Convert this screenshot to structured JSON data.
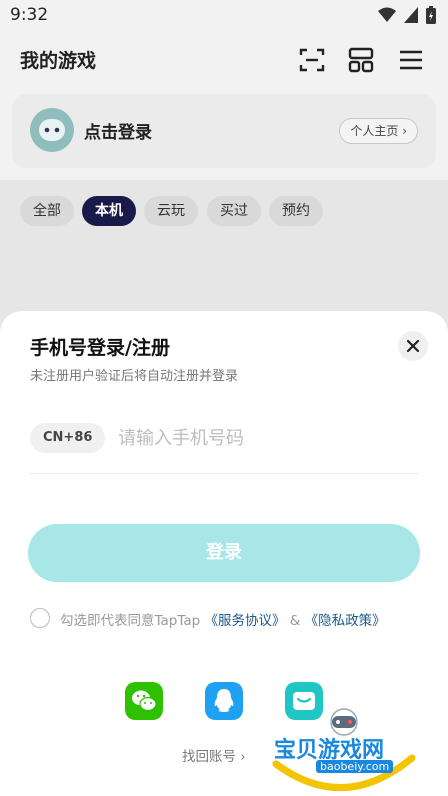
{
  "status_bar": {
    "time": "9:32"
  },
  "header": {
    "title": "我的游戏"
  },
  "profile": {
    "login_prompt": "点击登录",
    "home_button": "个人主页 ›"
  },
  "tabs": [
    {
      "label": "全部"
    },
    {
      "label": "本机",
      "active": true
    },
    {
      "label": "云玩"
    },
    {
      "label": "买过"
    },
    {
      "label": "预约"
    }
  ],
  "sheet": {
    "title": "手机号登录/注册",
    "subtitle": "未注册用户验证后将自动注册并登录",
    "country_code": "CN+86",
    "phone_placeholder": "请输入手机号码",
    "phone_value": "",
    "login_button": "登录",
    "agreement_prefix": "勾选即代表同意TapTap ",
    "terms_link": "《服务协议》",
    "and": " & ",
    "privacy_link": "《隐私政策》",
    "recover": "找回账号 ›"
  },
  "social_icons": [
    "wechat-icon",
    "qq-icon",
    "email-icon"
  ],
  "watermark": {
    "text": "宝贝游戏网",
    "url": "baobeiy.com"
  },
  "colors": {
    "accent": "#a7e7e8",
    "tab_active": "#1a1a4a",
    "wechat": "#2dc100",
    "qq": "#1ea1f2",
    "mail": "#20c6c6"
  }
}
